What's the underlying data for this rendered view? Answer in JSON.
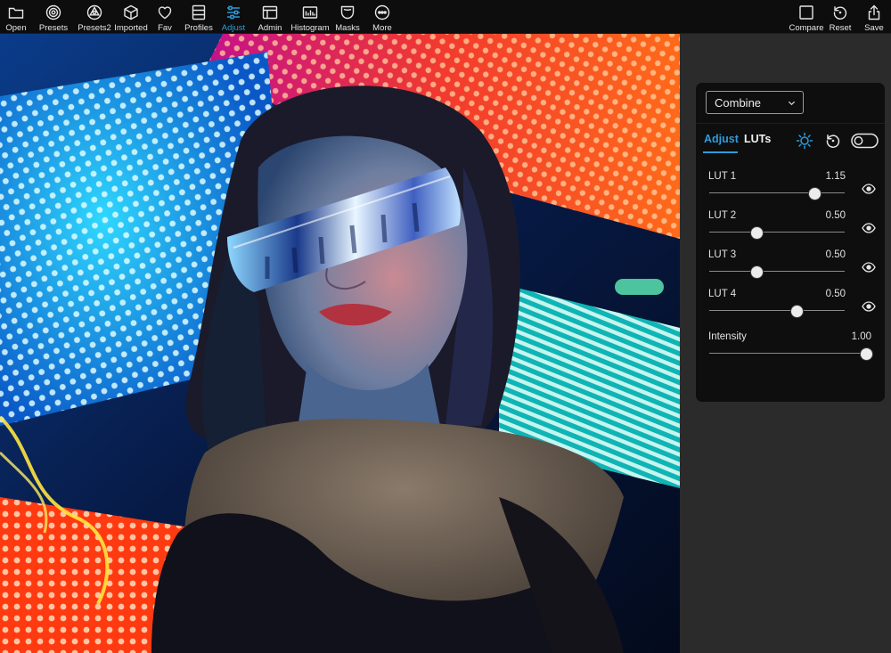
{
  "toolbar": {
    "left": [
      {
        "id": "open",
        "label": "Open",
        "icon": "folder-icon"
      },
      {
        "id": "presets",
        "label": "Presets",
        "icon": "presets-icon"
      },
      {
        "id": "presets2",
        "label": "Presets2",
        "icon": "presets2-icon"
      },
      {
        "id": "imported",
        "label": "Imported",
        "icon": "cube-icon"
      },
      {
        "id": "fav",
        "label": "Fav",
        "icon": "heart-icon"
      },
      {
        "id": "profiles",
        "label": "Profiles",
        "icon": "profiles-icon"
      },
      {
        "id": "adjust",
        "label": "Adjust",
        "icon": "sliders-icon",
        "active": true
      },
      {
        "id": "admin",
        "label": "Admin",
        "icon": "layout-icon"
      },
      {
        "id": "histogram",
        "label": "Histogram",
        "icon": "histogram-icon"
      },
      {
        "id": "masks",
        "label": "Masks",
        "icon": "mask-icon"
      },
      {
        "id": "more",
        "label": "More",
        "icon": "more-icon"
      }
    ],
    "right": [
      {
        "id": "compare",
        "label": "Compare",
        "icon": "compare-icon"
      },
      {
        "id": "reset",
        "label": "Reset",
        "icon": "reset-icon"
      },
      {
        "id": "save",
        "label": "Save",
        "icon": "share-icon"
      }
    ]
  },
  "panel": {
    "mode_select": {
      "value": "Combine"
    },
    "tabs": [
      {
        "id": "adjust",
        "label": "Adjust",
        "active": true
      },
      {
        "id": "luts",
        "label": "LUTs",
        "active": false
      }
    ],
    "header_icons": [
      "sun-icon",
      "rotate-reset-icon",
      "toggle-switch"
    ],
    "sliders": [
      {
        "label": "LUT 1",
        "value": "1.15",
        "fraction": 0.78
      },
      {
        "label": "LUT 2",
        "value": "0.50",
        "fraction": 0.35
      },
      {
        "label": "LUT 3",
        "value": "0.50",
        "fraction": 0.35
      },
      {
        "label": "LUT 4",
        "value": "0.50",
        "fraction": 0.65
      }
    ],
    "intensity": {
      "label": "Intensity",
      "value": "1.00",
      "fraction": 1.0
    }
  },
  "colors": {
    "accent": "#2d9cdb",
    "toolbar_bg": "#0d0d0d",
    "panel_bg": "#0e0e0e",
    "workspace_bg": "#2b2b2b"
  }
}
